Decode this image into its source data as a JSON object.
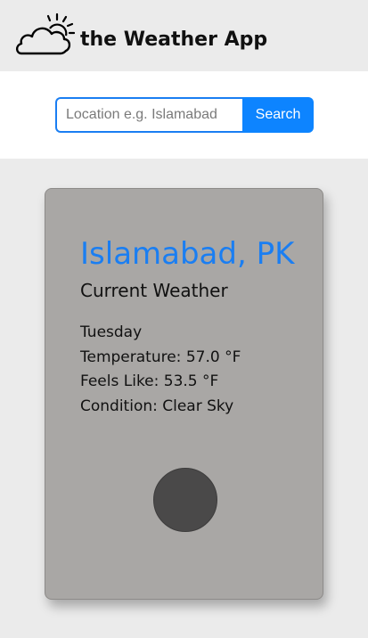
{
  "header": {
    "logo_icon": "cloud-sun-icon",
    "title": "the Weather App"
  },
  "search": {
    "placeholder": "Location e.g. Islamabad",
    "value": "",
    "button_label": "Search",
    "accent_color": "#0d84ff"
  },
  "weather": {
    "location": "Islamabad, PK",
    "heading": "Current Weather",
    "day": "Tuesday",
    "temperature": "Temperature: 57.0 °F",
    "feels_like": "Feels Like: 53.5 °F",
    "condition": "Condition: Clear Sky",
    "icon": "weather-condition-icon"
  }
}
